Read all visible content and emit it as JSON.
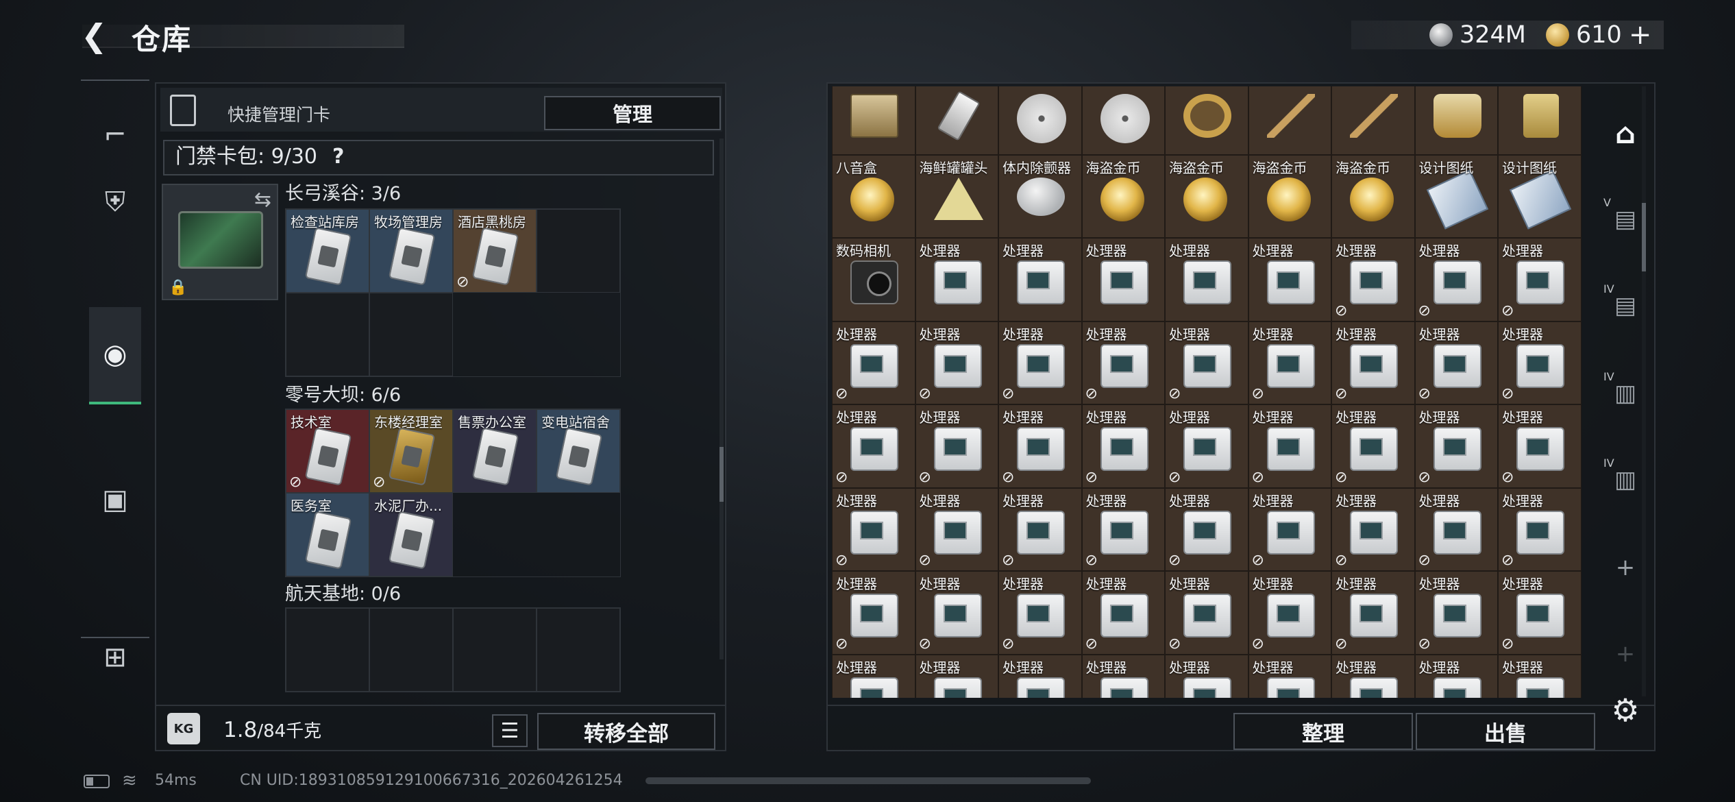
{
  "header": {
    "back_icon": "back-arrow-icon",
    "title": "仓库",
    "currency": [
      {
        "icon": "silver-coin-icon",
        "value": "324M"
      },
      {
        "icon": "gold-coin-icon",
        "value": "610"
      }
    ],
    "add_label": "+"
  },
  "sidenav": {
    "items": [
      {
        "icon": "pistol-icon",
        "glyph": "⌐",
        "active": false
      },
      {
        "icon": "backpack-icon",
        "glyph": "⛨",
        "active": false
      },
      {
        "icon": "bag-icon",
        "glyph": "◉",
        "active": true
      },
      {
        "icon": "case-icon",
        "glyph": "▣",
        "active": false
      },
      {
        "icon": "toolbox-icon",
        "glyph": "⊞",
        "active": false
      }
    ]
  },
  "left_panel": {
    "title": "快捷管理门卡",
    "manage_label": "管理",
    "card_bag_label": "门禁卡包: 9/30",
    "help_label": "?",
    "swap_icon": "⇆",
    "lock_icon": "🔒",
    "groups": [
      {
        "label": "长弓溪谷: 3/6",
        "slots": [
          {
            "name": "检查站库房",
            "color": "blue",
            "gold": false,
            "noloot": false
          },
          {
            "name": "牧场管理房",
            "color": "blue",
            "gold": false,
            "noloot": false
          },
          {
            "name": "酒店黑桃房",
            "color": "brown",
            "gold": false,
            "noloot": true
          },
          {
            "name": "",
            "color": "empty"
          },
          {
            "name": "",
            "color": "empty"
          },
          {
            "name": "",
            "color": "empty"
          }
        ]
      },
      {
        "label": "零号大坝: 6/6",
        "slots": [
          {
            "name": "技术室",
            "color": "red",
            "gold": false,
            "noloot": true
          },
          {
            "name": "东楼经理室",
            "color": "gold",
            "gold": true,
            "noloot": true
          },
          {
            "name": "售票办公室",
            "color": "dark",
            "gold": false,
            "noloot": false
          },
          {
            "name": "变电站宿舍",
            "color": "blue",
            "gold": false,
            "noloot": false
          },
          {
            "name": "医务室",
            "color": "blue",
            "gold": false,
            "noloot": false
          },
          {
            "name": "水泥厂办...",
            "color": "dark",
            "gold": false,
            "noloot": false
          }
        ]
      },
      {
        "label": "航天基地: 0/6",
        "slots": [
          {
            "name": "",
            "color": "empty"
          },
          {
            "name": "",
            "color": "empty"
          },
          {
            "name": "",
            "color": "empty"
          },
          {
            "name": "",
            "color": "empty"
          }
        ]
      }
    ],
    "weight_value": "1.8",
    "weight_max": "/84千克",
    "kg_label": "KG",
    "list_icon": "☰",
    "transfer_all_label": "转移全部"
  },
  "right_panel": {
    "items": [
      {
        "name": "",
        "pic": "box",
        "noloot": false
      },
      {
        "name": "",
        "pic": "usb",
        "noloot": false
      },
      {
        "name": "",
        "pic": "disc",
        "noloot": false
      },
      {
        "name": "",
        "pic": "disc",
        "noloot": false
      },
      {
        "name": "",
        "pic": "ring",
        "noloot": false
      },
      {
        "name": "",
        "pic": "pen",
        "noloot": false
      },
      {
        "name": "",
        "pic": "pen",
        "noloot": false
      },
      {
        "name": "",
        "pic": "vase",
        "noloot": false
      },
      {
        "name": "",
        "pic": "lighter",
        "noloot": false
      },
      {
        "name": "八音盒",
        "pic": "gcoin",
        "noloot": false
      },
      {
        "name": "海鲜罐罐头",
        "pic": "tri",
        "noloot": false
      },
      {
        "name": "体内除颤器",
        "pic": "pill",
        "noloot": false
      },
      {
        "name": "海盗金币",
        "pic": "gcoin",
        "noloot": false
      },
      {
        "name": "海盗金币",
        "pic": "gcoin",
        "noloot": false
      },
      {
        "name": "海盗金币",
        "pic": "gcoin",
        "noloot": false
      },
      {
        "name": "海盗金币",
        "pic": "gcoin",
        "noloot": false
      },
      {
        "name": "设计图纸",
        "pic": "bp",
        "noloot": false
      },
      {
        "name": "设计图纸",
        "pic": "bp",
        "noloot": false
      },
      {
        "name": "数码相机",
        "pic": "cam",
        "noloot": false
      },
      {
        "name": "处理器",
        "pic": "cpu",
        "noloot": false
      },
      {
        "name": "处理器",
        "pic": "cpu",
        "noloot": false
      },
      {
        "name": "处理器",
        "pic": "cpu",
        "noloot": false
      },
      {
        "name": "处理器",
        "pic": "cpu",
        "noloot": false
      },
      {
        "name": "处理器",
        "pic": "cpu",
        "noloot": false
      },
      {
        "name": "处理器",
        "pic": "cpu",
        "noloot": true
      },
      {
        "name": "处理器",
        "pic": "cpu",
        "noloot": true
      },
      {
        "name": "处理器",
        "pic": "cpu",
        "noloot": true
      }
    ],
    "cpu_rows_name": "处理器",
    "cpu_rows": 5,
    "cpu_partial_row": 1,
    "sort_label": "整理",
    "sell_label": "出售"
  },
  "right_nav": {
    "items": [
      {
        "icon": "home-vault-icon",
        "glyph": "⌂",
        "level": "",
        "active": true
      },
      {
        "icon": "case-v-icon",
        "glyph": "▤",
        "level": "V",
        "active": false
      },
      {
        "icon": "case-iv-icon",
        "glyph": "▤",
        "level": "IV",
        "active": false
      },
      {
        "icon": "case-iv-b-icon",
        "glyph": "▥",
        "level": "IV",
        "active": false
      },
      {
        "icon": "case-iv-c-icon",
        "glyph": "▥",
        "level": "IV",
        "active": false
      },
      {
        "icon": "add-case-icon",
        "glyph": "+",
        "level": "",
        "active": false
      },
      {
        "icon": "add-case-dim-icon",
        "glyph": "+",
        "level": "",
        "active": false
      }
    ],
    "settings_icon": "⚙"
  },
  "status_bar": {
    "ping": "54ms",
    "uid": "CN UID:189310859129100667316_202604261254"
  }
}
